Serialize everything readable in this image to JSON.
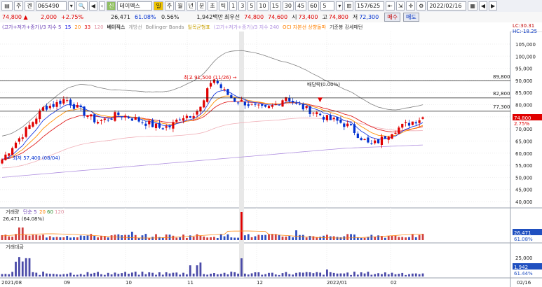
{
  "toolbar": {
    "market": "주",
    "mode": "겐",
    "code": "065490",
    "name": "테이펙스",
    "period_day": "일",
    "period_week": "주",
    "period_month": "월",
    "period_year": "년",
    "period_min": "분",
    "period_sec": "초",
    "period_tick": "틱",
    "intervals": [
      "1",
      "3",
      "5",
      "10",
      "15",
      "30",
      "45",
      "60",
      "5"
    ],
    "count": "157/625",
    "date": "2022/02/16"
  },
  "quote": {
    "price": "74,800 ▲",
    "change": "2,000",
    "change_pct": "+2.75%",
    "volume": "26,471",
    "vol_ratio": "61.08%",
    "turnover": "0.56%",
    "amount": "1,942백만",
    "low_label": "최우선",
    "bid": "74,800",
    "ask": "74,600",
    "open_label": "시",
    "open": "73,400",
    "high_label": "고",
    "high": "74,800",
    "low_label2": "저",
    "low": "72,300",
    "buy": "매수",
    "sell": "매도"
  },
  "legend": {
    "items": [
      {
        "text": "(고가+저가+종가)/3 지수 5",
        "color": "#6b3fb5"
      },
      {
        "text": "15",
        "color": "#0000e0"
      },
      {
        "text": "20",
        "color": "#ff8000"
      },
      {
        "text": "33",
        "color": "#e00000"
      },
      {
        "text": "120",
        "color": "#e090a0"
      },
      {
        "text": "베이직스",
        "color": "#333333"
      },
      {
        "text": "게방선",
        "color": "#999999"
      },
      {
        "text": "Bollinger Bands",
        "color": "#888888"
      },
      {
        "text": "일목균형표",
        "color": "#c8a000"
      },
      {
        "text": "(고가+저가+종가)/3 지수 240",
        "color": "#b090e0"
      },
      {
        "text": "OCI 자본선 상향돌파",
        "color": "#ff8000"
      },
      {
        "text": "기준봉 강세패턴",
        "color": "#333333"
      }
    ],
    "lc": "LC:30.31",
    "hc": "HC:-18.25"
  },
  "price_axis": {
    "ticks": [
      "105,000",
      "100,000",
      "95,000",
      "90,000",
      "85,000",
      "80,000",
      "75,000",
      "70,000",
      "65,000",
      "60,000",
      "55,000",
      "50,000",
      "45,000",
      "40,000"
    ],
    "current_price": "74,800",
    "current_pct": "2.75%"
  },
  "annotations": {
    "high_label": "최고 91,500 (11/26) →",
    "low_label": "← 최저 57,400 (08/04)",
    "dividend_label": "배당락(0.00%)",
    "level_1": "89,800",
    "level_2": "82,800",
    "level_3": "77,300"
  },
  "volume_panel": {
    "legend_name": "거래량",
    "legend_ma": [
      "단순 5",
      "20",
      "60",
      "120"
    ],
    "readout": "26,471 (64.08%)",
    "value_label": "26,471",
    "pct_label": "61.08%"
  },
  "amount_panel": {
    "legend_name": "거래대금",
    "tick_top": "25,000",
    "value_label": "1,942",
    "pct_label": "61.44%"
  },
  "date_axis": {
    "labels": [
      "2021/08",
      "09",
      "10",
      "11",
      "12",
      "2022/01",
      "02"
    ],
    "right_label": "02/16"
  },
  "colors": {
    "up": "#e00000",
    "down": "#0030d0",
    "bb_line": "#808080",
    "ma_purple": "#b090e0",
    "ma_pink": "#f0b0b8",
    "ma_red": "#e02020",
    "ma_orange": "#ff9000",
    "ma_blue": "#2040e0",
    "volume_bar": "#4a4aa8"
  },
  "chart_data": {
    "type": "candlestick",
    "title": "",
    "xlabel": "",
    "ylabel": "",
    "ylim": [
      37000,
      108000
    ],
    "x": [
      "2021/08",
      "09",
      "10",
      "11",
      "12",
      "2022/01",
      "02"
    ],
    "series": [
      {
        "name": "",
        "values": [
          57400,
          63000,
          68000,
          73500,
          79000,
          80000,
          82500,
          79000,
          76000,
          73000,
          74000,
          76000,
          75000,
          73500,
          72000,
          70500,
          71000,
          75000,
          76000,
          79000,
          91500,
          86000,
          82000,
          81000,
          79000,
          78000,
          80000,
          83500,
          80000,
          78000,
          76500,
          74000,
          73000,
          71000,
          67000,
          63000,
          65500,
          69000,
          71000,
          73000,
          74800
        ]
      }
    ]
  }
}
